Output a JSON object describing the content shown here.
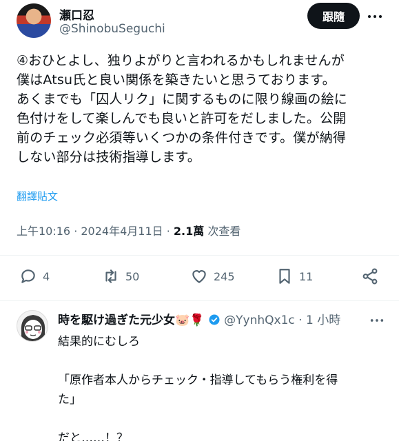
{
  "author": {
    "name": "瀬口忍",
    "handle": "@ShinobuSeguchi",
    "follow_label": "跟隨"
  },
  "tweet": {
    "lines": [
      "④おひとよし、独りよがりと言われるかもしれませんが",
      "僕はAtsu氏と良い関係を築きたいと思うております。",
      "あくまでも「囚人リク」に関するものに限り線画の絵に",
      "色付けをして楽しんでも良いと許可をだしました。公開",
      "前のチェック必須等いくつかの条件付きです。僕が納得",
      "しない部分は技術指導します。"
    ],
    "translate_label": "翻譯貼文",
    "time": "上午10:16 · 2024年4月11日 · ",
    "views_count": "2.1萬",
    "views_label": " 次查看"
  },
  "stats": {
    "replies": "4",
    "reposts": "50",
    "likes": "245",
    "bookmarks": "11"
  },
  "reply": {
    "name": "時を駆け過ぎた元少女🐷🌹",
    "handle": "@YynhQx1c",
    "time": " · 1 小時",
    "lines": [
      "結果的にむしろ",
      "",
      "「原作者本人からチェック・指導してもらう権利を得",
      "た」",
      "",
      "だと……！？"
    ]
  },
  "colors": {
    "accent": "#1d9bf0",
    "muted": "#536471",
    "text": "#0f1419",
    "verified": "#1d9bf0"
  }
}
